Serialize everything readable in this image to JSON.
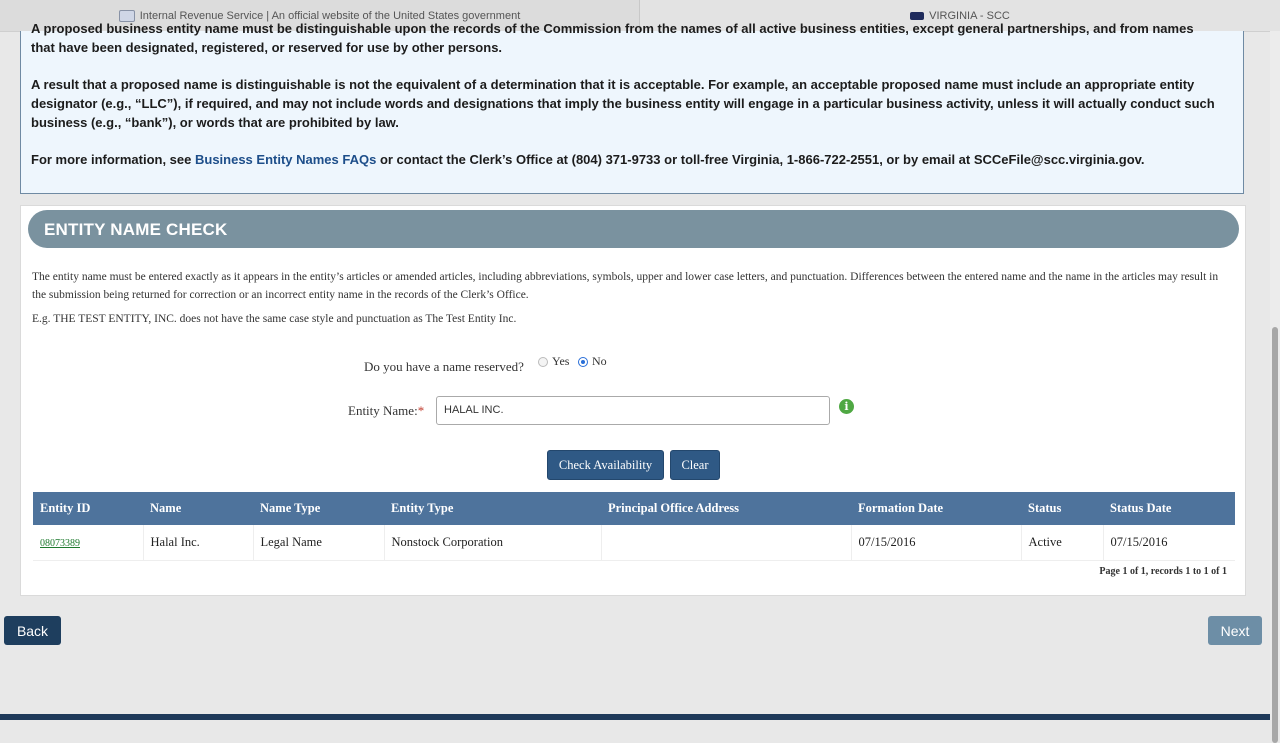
{
  "tabs": [
    {
      "title": "Internal Revenue Service | An official website of the United States government",
      "icon": "irs-seal-icon"
    },
    {
      "title": "VIRGINIA - SCC",
      "icon": "scc-icon"
    }
  ],
  "info": {
    "cutoff_line": "A proposed business entity name must be distinguishable upon the records of the Commission from the names of all active business entities, except general partnerships, and from names",
    "p1_line2": "that have been designated, registered, or reserved for use by other persons.",
    "p2": "A result that a proposed name is distinguishable is not the equivalent of a determination that it is acceptable. For example, an acceptable proposed name must include an appropriate entity designator (e.g., “LLC”), if required, and may not include words and designations that imply the business entity will engage in a particular business activity, unless it will actually conduct such business (e.g., “bank”), or words that are prohibited by law.",
    "p3_prefix": "For more information, see ",
    "p3_link": "Business Entity Names FAQs",
    "p3_suffix": " or contact the Clerk’s Office at (804) 371-9733 or toll-free Virginia, 1-866-722-2551, or by email at SCCeFile@scc.virginia.gov."
  },
  "section": {
    "title": "ENTITY NAME CHECK",
    "description": "The entity name must be entered exactly as it appears in the entity’s articles or amended articles, including abbreviations, symbols, upper and lower case letters, and punctuation. Differences between the entered name and the name in the articles may result in the submission being returned for correction or an incorrect entity name in the records of the Clerk’s Office.",
    "example": "E.g. THE TEST ENTITY, INC. does not have the same case style and punctuation as The Test Entity Inc."
  },
  "reserved": {
    "question": "Do you have a name reserved?",
    "options": [
      "Yes",
      "No"
    ],
    "selected": "No"
  },
  "entity_name": {
    "label": "Entity Name:",
    "required_mark": "*",
    "value": "HALAL INC."
  },
  "buttons": {
    "check": "Check Availability",
    "clear": "Clear",
    "back": "Back",
    "next": "Next"
  },
  "results": {
    "columns": [
      "Entity ID",
      "Name",
      "Name Type",
      "Entity Type",
      "Principal Office Address",
      "Formation Date",
      "Status",
      "Status Date"
    ],
    "rows": [
      {
        "entity_id": "08073389",
        "name": "Halal Inc.",
        "name_type": "Legal Name",
        "entity_type": "Nonstock Corporation",
        "address": "",
        "formation_date": "07/15/2016",
        "status": "Active",
        "status_date": "07/15/2016"
      }
    ],
    "pager": "Page 1 of 1, records 1 to 1 of 1"
  }
}
